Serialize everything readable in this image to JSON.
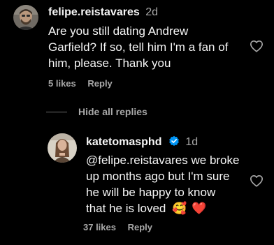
{
  "comments": [
    {
      "username": "felipe.reistavares",
      "time": "2d",
      "text_lines": [
        "Are you still dating Andrew",
        "Garfield? If so, tell him I'm a fan of",
        "him, please. Thank you"
      ],
      "likes": "5 likes",
      "reply_label": "Reply"
    }
  ],
  "replies_toggle": "Hide all replies",
  "reply": {
    "username": "katetomasphd",
    "time": "1d",
    "text_lines": [
      "@felipe.reistavares we broke",
      "up months ago but I'm sure",
      "he will be happy to know",
      "that he is loved"
    ],
    "emojis": [
      "🥰",
      "❤️"
    ],
    "likes": "37 likes",
    "reply_label": "Reply"
  },
  "colors": {
    "background": "#000000",
    "primary_text": "#f5f5f5",
    "secondary_text": "#a8a8a8",
    "verified": "#0095f6",
    "heart_emoji": "#ff3040"
  },
  "icons": {
    "like": "heart-outline-icon",
    "verified": "verified-badge-icon"
  }
}
